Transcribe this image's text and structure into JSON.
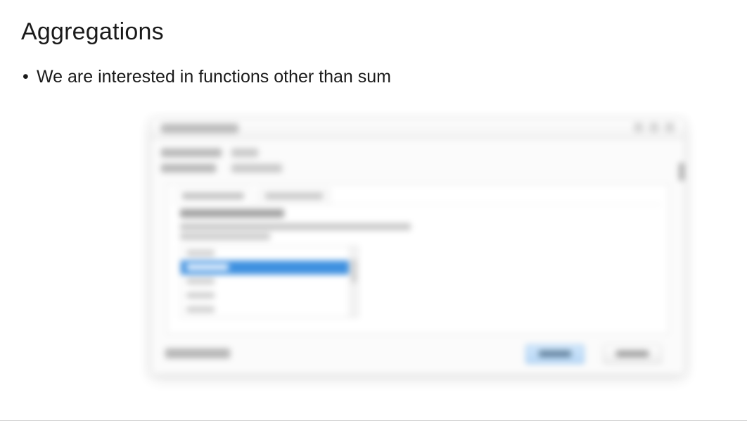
{
  "title": "Aggregations",
  "bullets": [
    "We are interested in functions other than sum"
  ],
  "dialog": {
    "window_title": "Value Field Settings",
    "row1_label": "Source Name:",
    "row1_value": "Sales",
    "row2_label": "Custom Name:",
    "row2_value": "Sum of Sales",
    "tab_active": "Summarize Values By",
    "tab_other": "Show Values As",
    "section_heading": "Summarize value field by",
    "section_desc_line1": "Choose the type of calculation that you want to use to summarize",
    "section_desc_line2": "data from the selected field",
    "aggregation_options": [
      "Sum",
      "Count",
      "Average",
      "Max",
      "Min"
    ],
    "selected_index": 1,
    "learn_more": "Number Format...",
    "ok_label": "OK",
    "cancel_label": "Cancel"
  }
}
